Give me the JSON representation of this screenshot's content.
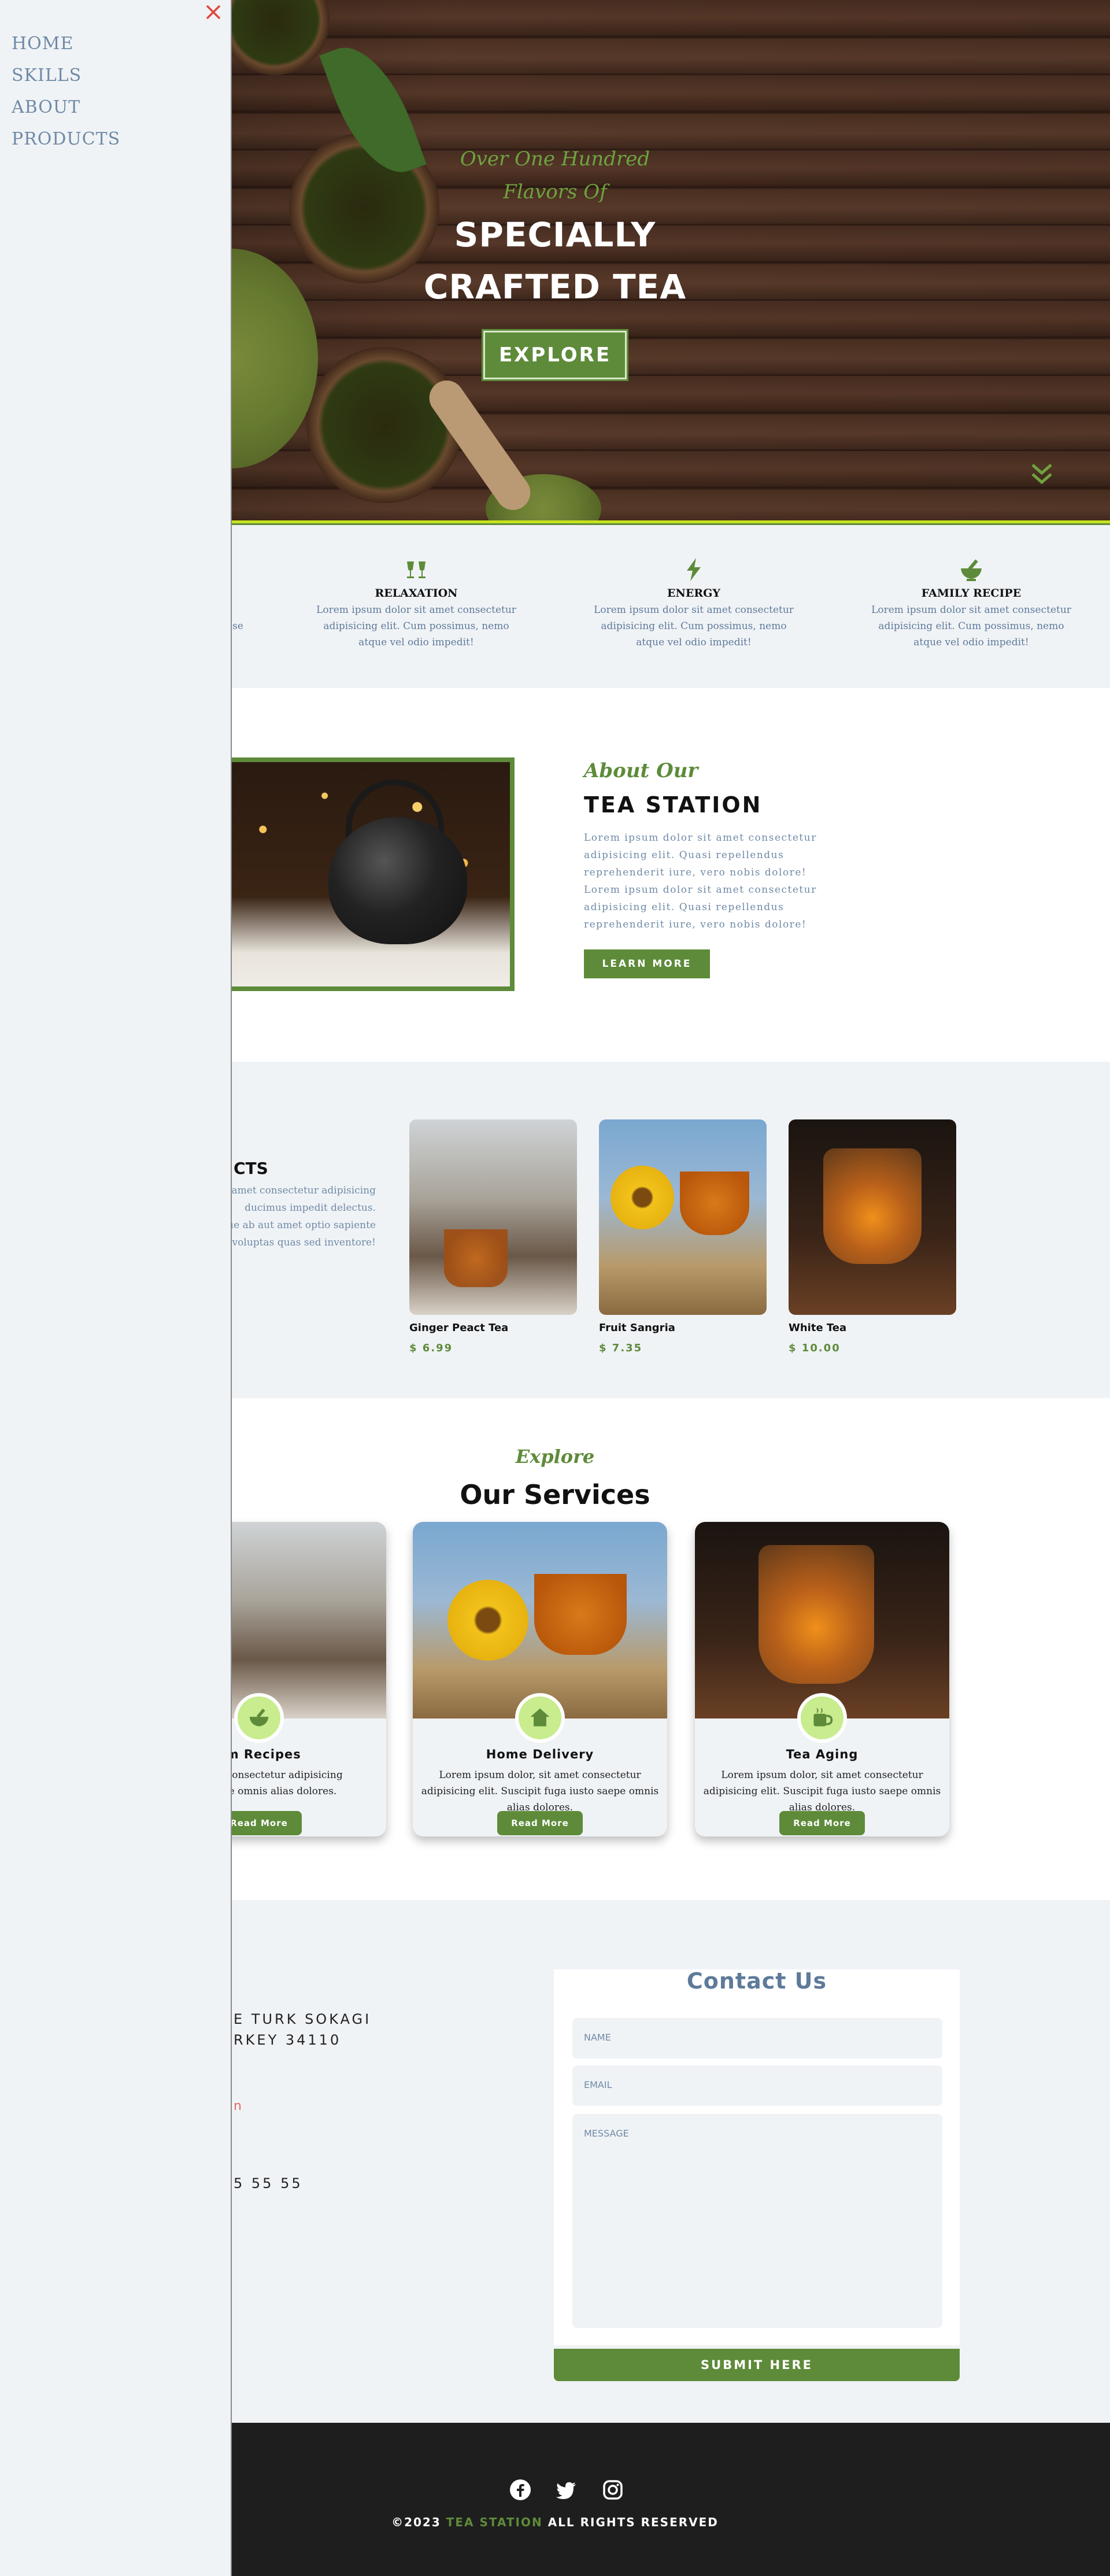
{
  "sidebar": {
    "nav": [
      "HOME",
      "SKILLS",
      "ABOUT",
      "PRODUCTS"
    ]
  },
  "hero": {
    "subtitle_line1": "Over One Hundred",
    "subtitle_line2": "Flavors Of",
    "title_line1": "SPECIALLY",
    "title_line2": "CRAFTED TEA",
    "button": "EXPLORE"
  },
  "features": [
    {
      "icon": "cups-icon",
      "title": "RELAXATION",
      "text": "Lorem ipsum dolor sit amet consectetur adipisicing elit. Cum possimus, nemo atque vel odio impedit!"
    },
    {
      "icon": "bolt-icon",
      "title": "ENERGY",
      "text": "Lorem ipsum dolor sit amet consectetur adipisicing elit. Cum possimus, nemo atque vel odio impedit!"
    },
    {
      "icon": "mortar-icon",
      "title": "FAMILY RECIPE",
      "text": "Lorem ipsum dolor sit amet consectetur adipisicing elit. Cum possimus, nemo atque vel odio impedit!"
    }
  ],
  "features_partial_text": "se",
  "about": {
    "subtitle": "About Our",
    "title": "TEA STATION",
    "text": "Lorem ipsum dolor sit amet consectetur adipisicing elit. Quasi repellendus reprehenderit iure, vero nobis dolore! Lorem ipsum dolor sit amet consectetur adipisicing elit. Quasi repellendus reprehenderit iure, vero nobis dolore!",
    "button": "LEARN MORE"
  },
  "products": {
    "title_partial": "CTS",
    "text_partial": "t, amet consectetur adipisicing\nducimus impedit delectus.\nque ab aut amet optio sapiente\nt voluptas quas sed inventore!",
    "items": [
      {
        "name": "Ginger Peact Tea",
        "price": "$ 6.99"
      },
      {
        "name": "Fruit Sangria",
        "price": "$ 7.35"
      },
      {
        "name": "White Tea",
        "price": "$ 10.00"
      }
    ]
  },
  "services": {
    "subtitle": "Explore",
    "title": "Our Services",
    "items": [
      {
        "icon": "bowl-icon",
        "name": "om Recipes",
        "text": "r sit amet consectetur adipisicing\nnsto saepe omnis alias dolores.",
        "button": "Read More"
      },
      {
        "icon": "home-icon",
        "name": "Home Delivery",
        "text": "Lorem ipsum dolor, sit amet consectetur adipisicing elit. Suscipit fuga iusto saepe omnis alias dolores.",
        "button": "Read More"
      },
      {
        "icon": "mug-icon",
        "name": "Tea Aging",
        "text": "Lorem ipsum dolor, sit amet consectetur adipisicing elit. Suscipit fuga iusto saepe omnis alias dolores.",
        "button": "Read More"
      }
    ]
  },
  "contact": {
    "address_line1": "E TURK SOKAGI",
    "address_line2": "RKEY 34110",
    "email_partial": "n",
    "phone_partial": "5 55 55",
    "form_title": "Contact Us",
    "name_placeholder": "NAME",
    "email_placeholder": "EMAIL",
    "message_placeholder": "MESSAGE",
    "submit": "SUBMIT HERE"
  },
  "footer": {
    "copy_prefix": "©2023",
    "brand": "TEA STATION",
    "copy_suffix": "ALL RIGHTS RESERVED"
  },
  "colors": {
    "accent": "#5e8b3a",
    "highlight": "#c6e21f",
    "light_bg": "#f0f3f6",
    "muted_text": "#6f8aa6",
    "footer_bg": "#1e1e1e"
  }
}
